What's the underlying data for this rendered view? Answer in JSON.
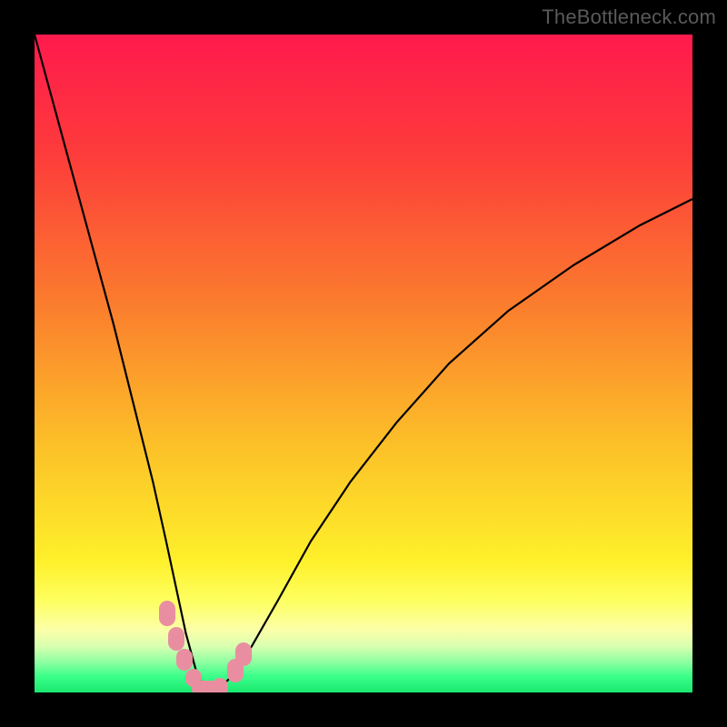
{
  "watermark": "TheBottleneck.com",
  "colors": {
    "bg_black": "#000000",
    "gradient_stops": [
      {
        "offset": 0.0,
        "color": "#ff1a4d"
      },
      {
        "offset": 0.18,
        "color": "#fd3b3b"
      },
      {
        "offset": 0.4,
        "color": "#fb7a2e"
      },
      {
        "offset": 0.63,
        "color": "#fcc228"
      },
      {
        "offset": 0.8,
        "color": "#fef02a"
      },
      {
        "offset": 0.86,
        "color": "#feff60"
      },
      {
        "offset": 0.905,
        "color": "#fbffa8"
      },
      {
        "offset": 0.93,
        "color": "#d8ffb0"
      },
      {
        "offset": 0.955,
        "color": "#8affa0"
      },
      {
        "offset": 0.975,
        "color": "#3cff8a"
      },
      {
        "offset": 1.0,
        "color": "#19e86f"
      }
    ],
    "marker": "#e98ea0",
    "curve": "#000000"
  },
  "chart_data": {
    "type": "line",
    "title": "",
    "xlabel": "",
    "ylabel": "",
    "xlim": [
      0,
      100
    ],
    "ylim": [
      0,
      100
    ],
    "series": [
      {
        "name": "bottleneck-curve",
        "x": [
          0,
          3,
          6,
          9,
          12,
          15,
          18,
          20,
          21.5,
          23,
          24.5,
          26,
          27,
          28,
          30,
          33,
          37,
          42,
          48,
          55,
          63,
          72,
          82,
          92,
          100
        ],
        "y": [
          100,
          89,
          78,
          67,
          56,
          44,
          32,
          23,
          16,
          9,
          3.5,
          0.3,
          0.1,
          0.5,
          2.5,
          7,
          14,
          23,
          32,
          41,
          50,
          58,
          65,
          71,
          75
        ]
      }
    ],
    "markers": [
      {
        "x": 20.2,
        "y": 12.0,
        "w": 18,
        "h": 28
      },
      {
        "x": 21.5,
        "y": 8.2,
        "w": 18,
        "h": 26
      },
      {
        "x": 22.8,
        "y": 5.0,
        "w": 18,
        "h": 24
      },
      {
        "x": 24.2,
        "y": 2.2,
        "w": 18,
        "h": 20
      },
      {
        "x": 26.0,
        "y": 0.6,
        "w": 30,
        "h": 18
      },
      {
        "x": 28.2,
        "y": 0.8,
        "w": 18,
        "h": 20
      },
      {
        "x": 30.5,
        "y": 3.3,
        "w": 18,
        "h": 26
      },
      {
        "x": 31.8,
        "y": 5.8,
        "w": 18,
        "h": 26
      }
    ]
  }
}
